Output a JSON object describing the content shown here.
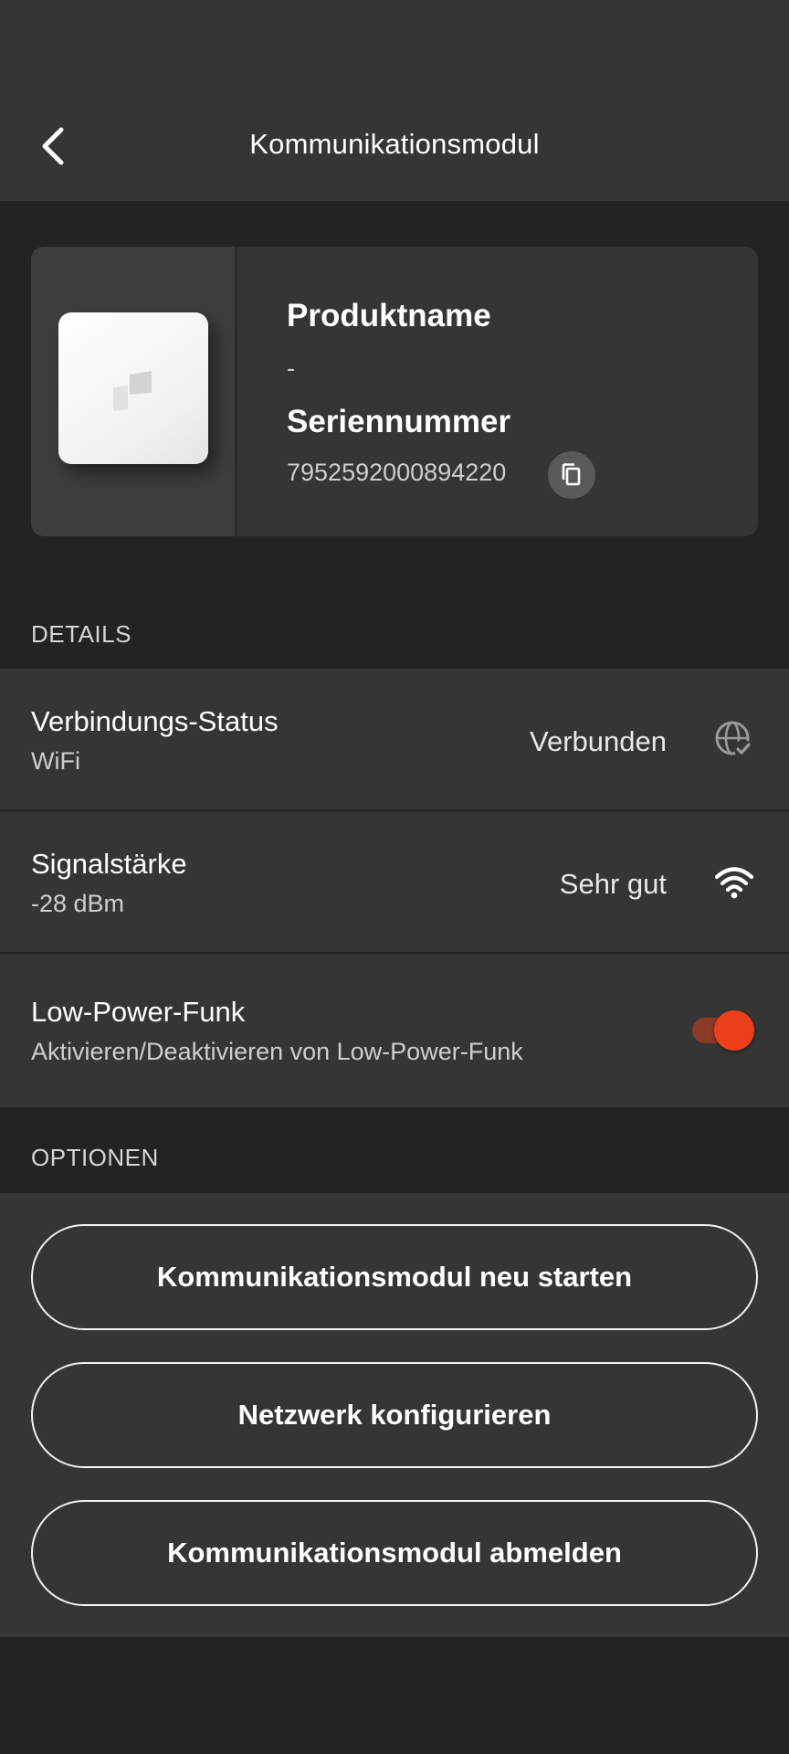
{
  "header": {
    "title": "Kommunikationsmodul",
    "back_icon": "chevron-left-icon"
  },
  "product": {
    "name_label": "Produktname",
    "name_value": "-",
    "serial_label": "Seriennummer",
    "serial_value": "7952592000894220",
    "copy_icon": "copy-icon"
  },
  "details": {
    "section_title": "DETAILS",
    "connection": {
      "title": "Verbindungs-Status",
      "subtitle": "WiFi",
      "value": "Verbunden",
      "icon": "globe-check-icon"
    },
    "signal": {
      "title": "Signalstärke",
      "subtitle": "-28 dBm",
      "value": "Sehr gut",
      "icon": "wifi-icon"
    },
    "low_power": {
      "title": "Low-Power-Funk",
      "subtitle": "Aktivieren/Deaktivieren von Low-Power-Funk",
      "enabled": true
    }
  },
  "options": {
    "section_title": "OPTIONEN",
    "restart_label": "Kommunikationsmodul neu starten",
    "configure_label": "Netzwerk konfigurieren",
    "logout_label": "Kommunikationsmodul abmelden"
  },
  "colors": {
    "background": "#232323",
    "surface": "#353535",
    "accent": "#ee3f1b",
    "text": "#ffffff"
  }
}
